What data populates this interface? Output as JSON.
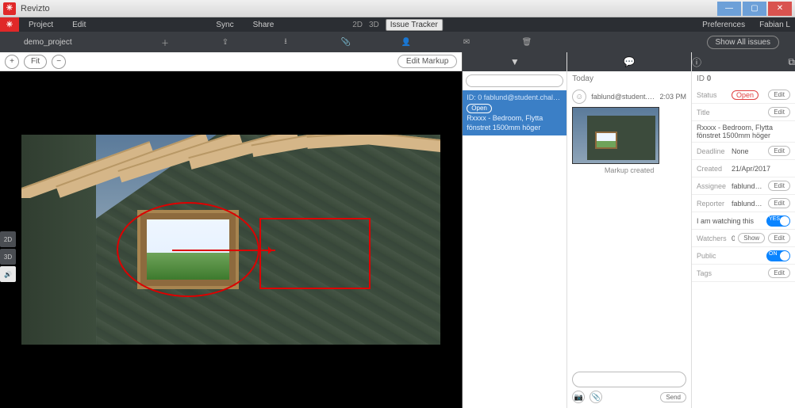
{
  "app": {
    "title": "Revizto",
    "brand_glyph": "✳"
  },
  "window_buttons": {
    "min": "—",
    "max": "▢",
    "close": "✕"
  },
  "menubar": {
    "items": [
      "Project",
      "Edit",
      "Sync",
      "Share"
    ],
    "center": {
      "mode2d": "2D",
      "mode3d": "3D",
      "issue_tracker": "Issue Tracker"
    },
    "right": {
      "preferences": "Preferences",
      "user": "Fabian L"
    }
  },
  "toolrow": {
    "breadcrumb": "demo_project",
    "icons": [
      "add-icon",
      "export-icon",
      "download-icon",
      "attach-icon",
      "assign-icon",
      "mail-icon",
      "trash-icon"
    ],
    "show_all": "Show All issues"
  },
  "viewer": {
    "buttons": {
      "plus": "+",
      "fit": "Fit",
      "minus": "−",
      "edit_markup": "Edit Markup"
    }
  },
  "view_toggles": {
    "twod": "2D",
    "threed": "3D",
    "speaker": "🔊"
  },
  "issues": {
    "filter_icon": "▼",
    "date_header": "Today",
    "search_placeholder": "",
    "card": {
      "id_line": "ID: 0    fablund@student.chal…",
      "status": "Open",
      "title": "Rxxxx - Bedroom, Flytta fönstret 1500mm höger"
    }
  },
  "thread": {
    "chat_icon": "💬",
    "user": "fablund@student.chal…",
    "time": "2:03 PM",
    "thumb_caption": "Markup created"
  },
  "compose": {
    "cam_icon": "📷",
    "attach_icon": "📎",
    "send": "Send"
  },
  "details": {
    "info_icon": "ⓘ",
    "ext_icon": "⧉",
    "id_label": "ID",
    "id_value": "0",
    "edit": "Edit",
    "show": "Show",
    "rows": {
      "status": {
        "label": "Status",
        "value": "Open"
      },
      "title": {
        "label": "Title",
        "value": "Rxxxx - Bedroom, Flytta fönstret 1500mm höger"
      },
      "deadline": {
        "label": "Deadline",
        "value": "None"
      },
      "created": {
        "label": "Created",
        "value": "21/Apr/2017"
      },
      "assignee": {
        "label": "Assignee",
        "value": "fablund@student.chalmers.se"
      },
      "reporter": {
        "label": "Reporter",
        "value": "fablund@student.chalmers.se"
      },
      "watching": {
        "label": "I am watching this",
        "toggle": "YES"
      },
      "watchers": {
        "label": "Watchers",
        "value": "0"
      },
      "public": {
        "label": "Public",
        "toggle": "ON"
      },
      "tags": {
        "label": "Tags",
        "value": ""
      }
    }
  }
}
